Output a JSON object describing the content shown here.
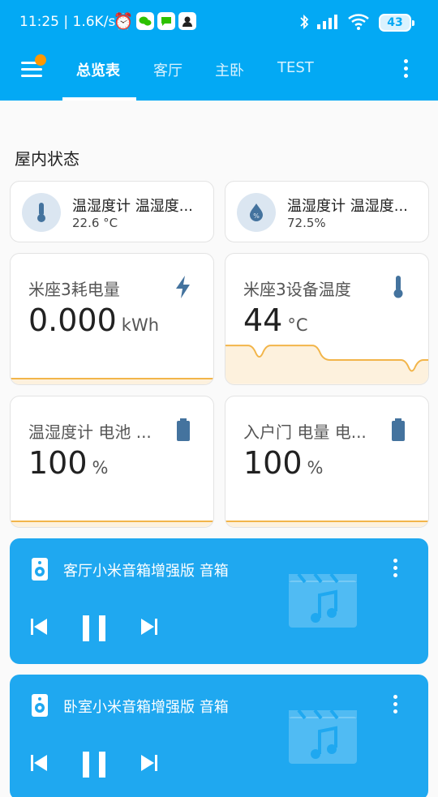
{
  "status_bar": {
    "time_speed": "11:25 | 1.6K/s",
    "battery": "43"
  },
  "header": {
    "tabs": [
      {
        "label": "总览表"
      },
      {
        "label": "客厅"
      },
      {
        "label": "主卧"
      },
      {
        "label": "TEST"
      }
    ]
  },
  "section": {
    "title": "屋内状态"
  },
  "mini_cards": [
    {
      "name": "温湿度计 温湿度...",
      "value": "22.6 °C",
      "icon": "thermometer-icon"
    },
    {
      "name": "温湿度计 温湿度...",
      "value": "72.5%",
      "icon": "humidity-icon"
    }
  ],
  "sensor_cards": [
    {
      "name": "米座3耗电量",
      "value": "0.000",
      "unit": "kWh",
      "icon": "lightning-icon"
    },
    {
      "name": "米座3设备温度",
      "value": "44",
      "unit": "°C",
      "icon": "thermometer-icon"
    },
    {
      "name": "温湿度计 电池 ...",
      "value": "100",
      "unit": "%",
      "icon": "battery-icon"
    },
    {
      "name": "入户门 电量 电...",
      "value": "100",
      "unit": "%",
      "icon": "battery-icon"
    }
  ],
  "media_players": [
    {
      "title": "客厅小米音箱增强版 音箱"
    },
    {
      "title": "卧室小米音箱增强版 音箱"
    }
  ],
  "colors": {
    "header": "#03a9f4",
    "media_card": "#1fa8f0",
    "graph_line": "#f2b54a",
    "graph_fill": "#fdf1dd",
    "icon": "#44739e",
    "badge": "#ff9800"
  }
}
